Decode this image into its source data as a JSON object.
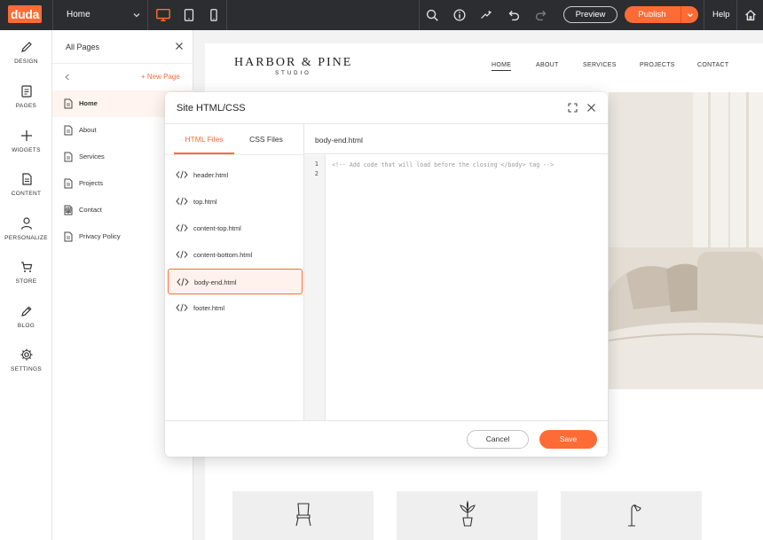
{
  "topbar": {
    "logo": "duda",
    "current_page": "Home",
    "preview_label": "Preview",
    "publish_label": "Publish",
    "help_label": "Help",
    "icons": [
      "desktop-icon",
      "tablet-icon",
      "mobile-icon",
      "search-icon",
      "info-icon",
      "ai-icon",
      "undo-icon",
      "redo-icon",
      "home-icon"
    ]
  },
  "rail": {
    "items": [
      {
        "label": "DESIGN",
        "icon": "pencil-icon"
      },
      {
        "label": "PAGES",
        "icon": "pages-icon"
      },
      {
        "label": "WIDGETS",
        "icon": "plus-icon"
      },
      {
        "label": "CONTENT",
        "icon": "document-icon"
      },
      {
        "label": "PERSONALIZE",
        "icon": "person-icon"
      },
      {
        "label": "STORE",
        "icon": "cart-icon"
      },
      {
        "label": "BLOG",
        "icon": "blog-pen-icon"
      },
      {
        "label": "SETTINGS",
        "icon": "gear-icon"
      }
    ]
  },
  "pages_panel": {
    "title": "All Pages",
    "new_page_label": "+ New Page",
    "pages": [
      {
        "label": "Home"
      },
      {
        "label": "About"
      },
      {
        "label": "Services"
      },
      {
        "label": "Projects"
      },
      {
        "label": "Contact"
      },
      {
        "label": "Privacy Policy"
      }
    ]
  },
  "site": {
    "brand_main": "HARBOR & PINE",
    "brand_sub": "STUDIO",
    "nav": [
      "HOME",
      "ABOUT",
      "SERVICES",
      "PROJECTS",
      "CONTACT"
    ]
  },
  "modal": {
    "title": "Site HTML/CSS",
    "tabs": [
      "HTML Files",
      "CSS Files"
    ],
    "files": [
      "header.html",
      "top.html",
      "content-top.html",
      "content-bottom.html",
      "body-end.html",
      "footer.html"
    ],
    "selected_file": "body-end.html",
    "editor": {
      "line_numbers": [
        "1",
        "2"
      ],
      "code": "<!-- Add code that will load before the closing </body> tag -->"
    },
    "cancel_label": "Cancel",
    "save_label": "Save"
  },
  "colors": {
    "accent": "#ff6b35",
    "topbar": "#2b2d31"
  }
}
